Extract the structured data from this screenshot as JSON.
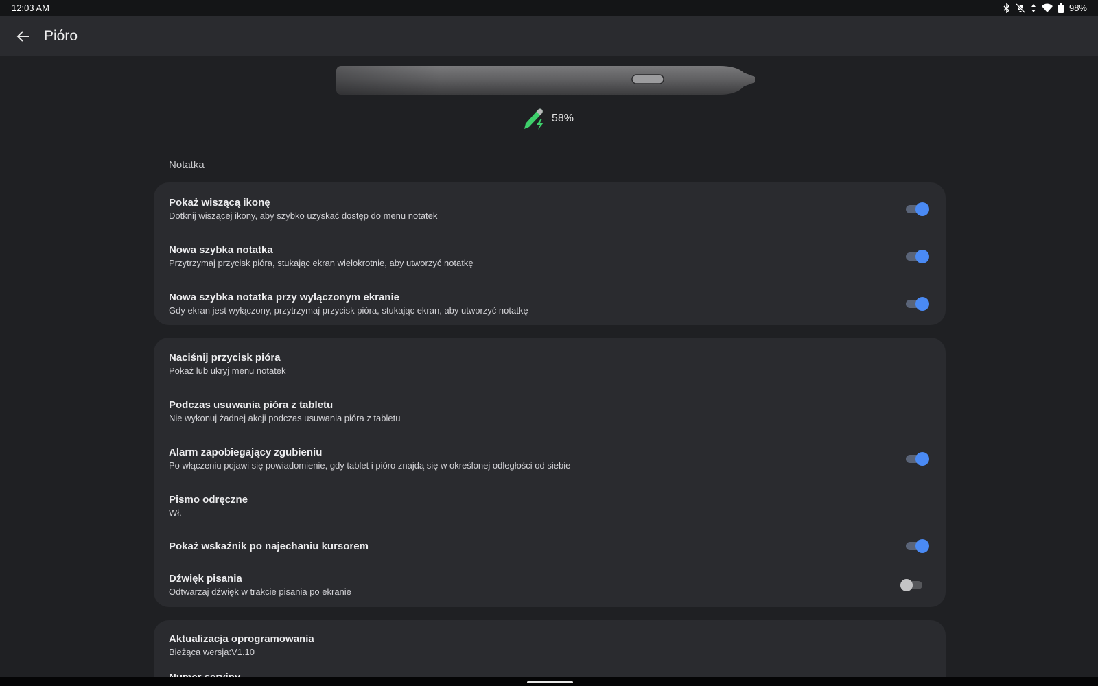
{
  "status_bar": {
    "time": "12:03 AM",
    "battery": "98%",
    "icons": [
      "bluetooth-icon",
      "silent-icon",
      "data-arrows-icon",
      "wifi-icon",
      "battery-icon"
    ]
  },
  "app_bar": {
    "title": "Pióro"
  },
  "pen": {
    "battery_level": "58%",
    "battery_fraction": 0.58
  },
  "section_title": "Notatka",
  "card1": {
    "rows": [
      {
        "title": "Pokaż wiszącą ikonę",
        "subtitle": "Dotknij wiszącej ikony, aby szybko uzyskać dostęp do menu notatek",
        "toggle": true
      },
      {
        "title": "Nowa szybka notatka",
        "subtitle": "Przytrzymaj przycisk pióra, stukając ekran wielokrotnie, aby utworzyć notatkę",
        "toggle": true
      },
      {
        "title": "Nowa szybka notatka przy wyłączonym ekranie",
        "subtitle": "Gdy ekran jest wyłączony, przytrzymaj przycisk pióra, stukając ekran, aby utworzyć notatkę",
        "toggle": true
      }
    ]
  },
  "card2": {
    "rows": [
      {
        "title": "Naciśnij przycisk pióra",
        "subtitle": "Pokaż lub ukryj menu notatek"
      },
      {
        "title": "Podczas usuwania pióra z tabletu",
        "subtitle": "Nie wykonuj żadnej akcji podczas usuwania pióra z tabletu"
      },
      {
        "title": "Alarm zapobiegający zgubieniu",
        "subtitle": "Po włączeniu pojawi się powiadomienie, gdy tablet i pióro znajdą się w określonej odległości od siebie",
        "toggle": true
      },
      {
        "title": "Pismo odręczne",
        "subtitle": "Wł."
      },
      {
        "title": "Pokaż wskaźnik po najechaniu kursorem",
        "toggle": true
      },
      {
        "title": "Dźwięk pisania",
        "subtitle": "Odtwarzaj dźwięk w trakcie pisania po ekranie",
        "toggle": false
      }
    ]
  },
  "card3": {
    "rows": [
      {
        "title": "Aktualizacja oprogramowania",
        "subtitle": "Bieżąca wersja:V1.10"
      },
      {
        "title": "Numer seryjny"
      }
    ]
  },
  "colors": {
    "accent": "#4a8af4",
    "background": "#1f2023",
    "card": "#2a2b2f",
    "pen_icon": "#3ecf6b"
  }
}
